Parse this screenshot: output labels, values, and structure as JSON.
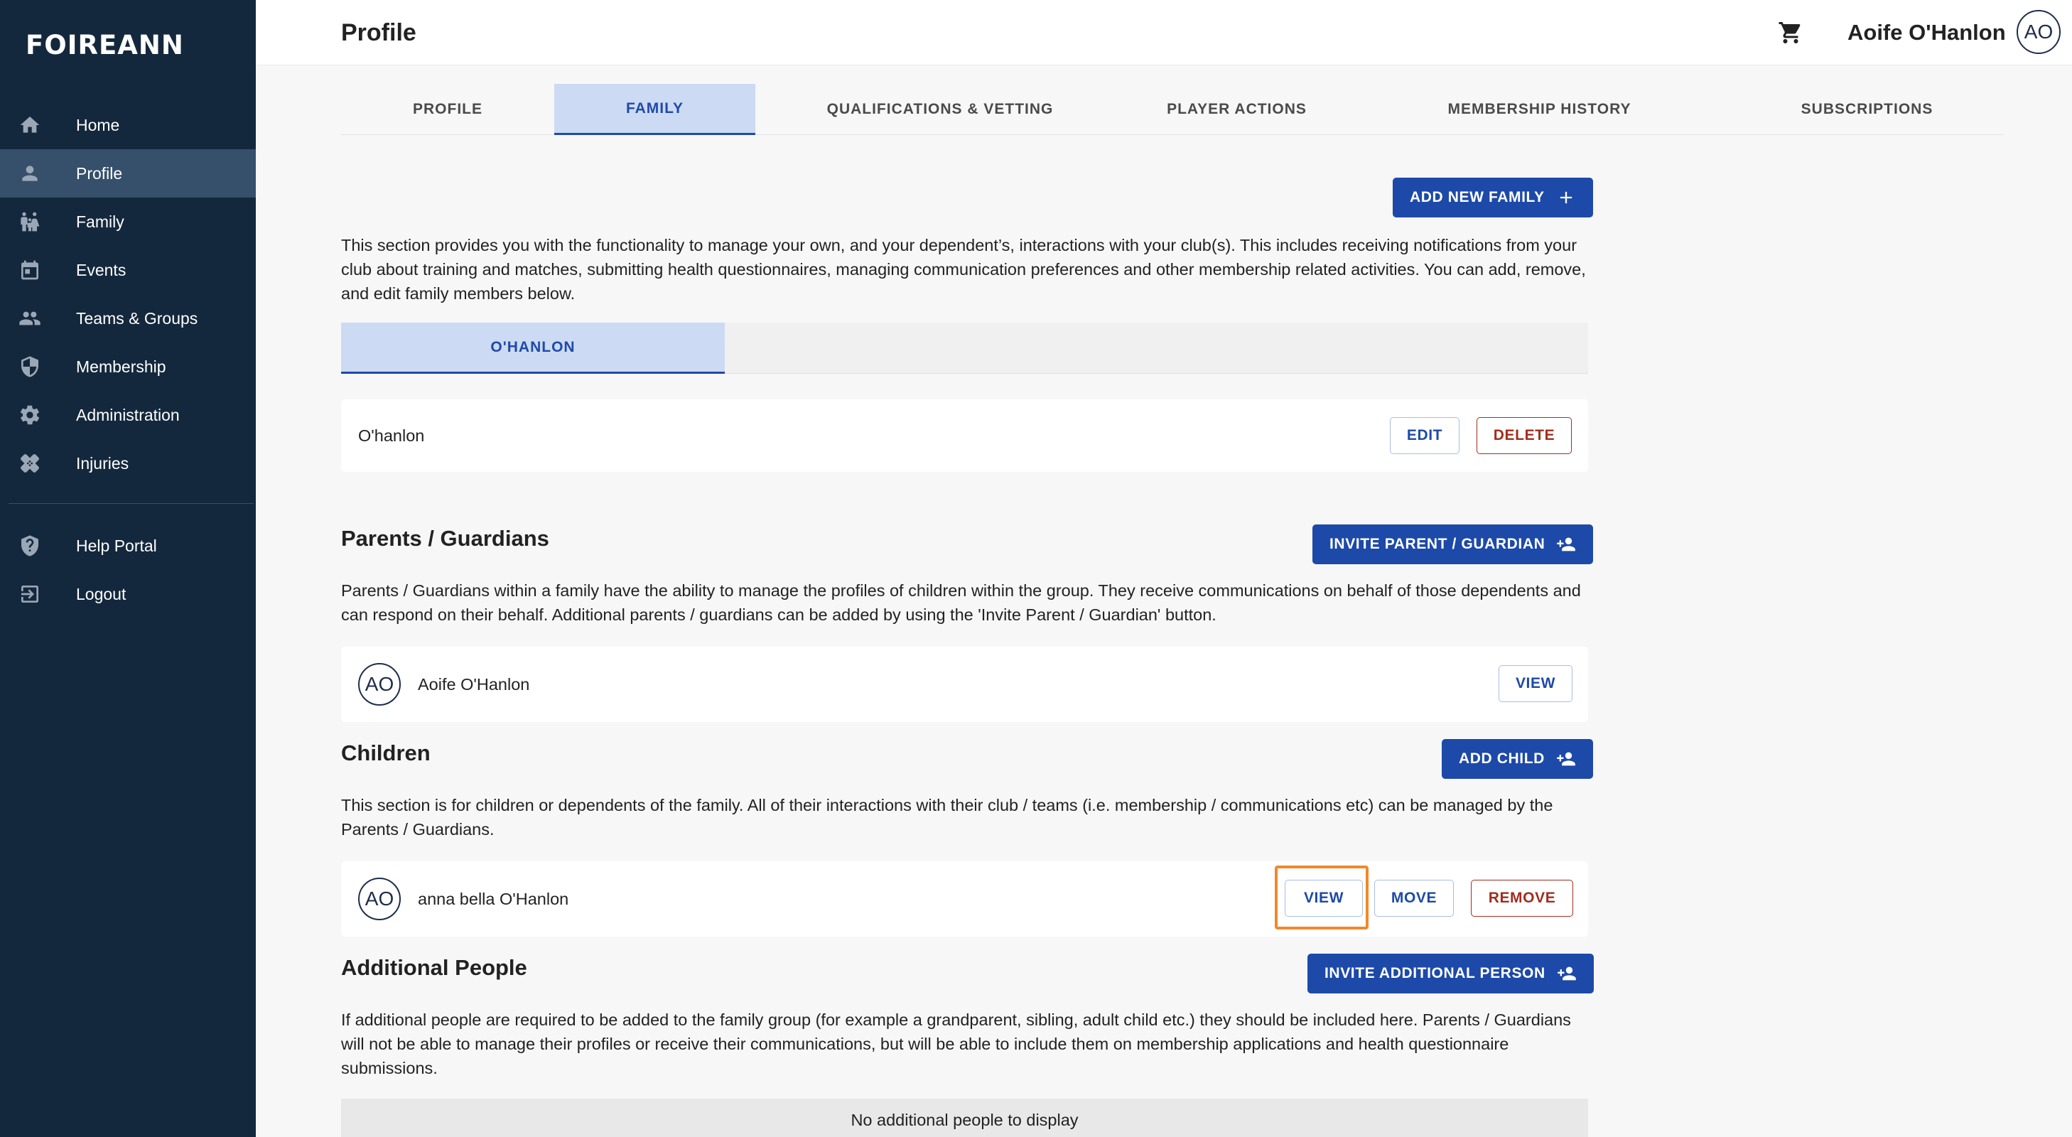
{
  "brand": {
    "logo": "FOIREANN"
  },
  "sidebar": {
    "items": [
      {
        "label": "Home",
        "icon": "home-icon"
      },
      {
        "label": "Profile",
        "icon": "person-icon",
        "active": true
      },
      {
        "label": "Family",
        "icon": "family-icon"
      },
      {
        "label": "Events",
        "icon": "calendar-icon"
      },
      {
        "label": "Teams & Groups",
        "icon": "group-icon"
      },
      {
        "label": "Membership",
        "icon": "shield-icon"
      },
      {
        "label": "Administration",
        "icon": "gear-icon"
      },
      {
        "label": "Injuries",
        "icon": "bandage-icon"
      }
    ],
    "secondary": [
      {
        "label": "Help Portal",
        "icon": "help-icon"
      },
      {
        "label": "Logout",
        "icon": "logout-icon"
      }
    ]
  },
  "header": {
    "title": "Profile",
    "user_name": "Aoife O'Hanlon",
    "avatar_initials": "AO"
  },
  "tabs": [
    {
      "label": "PROFILE"
    },
    {
      "label": "FAMILY",
      "active": true
    },
    {
      "label": "QUALIFICATIONS & VETTING"
    },
    {
      "label": "PLAYER ACTIONS"
    },
    {
      "label": "MEMBERSHIP HISTORY"
    },
    {
      "label": "SUBSCRIPTIONS"
    }
  ],
  "family": {
    "add_button": "ADD NEW FAMILY",
    "intro": "This section provides you with the functionality to manage your own, and your dependent’s, interactions with your club(s). This includes receiving notifications from your club about training and matches, submitting health questionnaires, managing communication preferences and other membership related activities. You can add, remove, and edit family members below.",
    "family_tab": "O'HANLON",
    "family_name": "O'hanlon",
    "edit_button": "EDIT",
    "delete_button": "DELETE"
  },
  "parents": {
    "title": "Parents / Guardians",
    "invite_button": "INVITE PARENT / GUARDIAN",
    "description": "Parents / Guardians within a family have the ability to manage the profiles of children within the group. They receive communications on behalf of those dependents and can respond on their behalf. Additional parents / guardians can be added by using the 'Invite Parent / Guardian' button.",
    "member": {
      "initials": "AO",
      "name": "Aoife O'Hanlon",
      "view_button": "VIEW"
    }
  },
  "children": {
    "title": "Children",
    "add_button": "ADD CHILD",
    "description": "This section is for children or dependents of the family. All of their interactions with their club / teams (i.e. membership / communications etc) can be managed by the Parents / Guardians.",
    "member": {
      "initials": "AO",
      "name": "anna bella O'Hanlon",
      "view_button": "VIEW",
      "move_button": "MOVE",
      "remove_button": "REMOVE"
    }
  },
  "additional": {
    "title": "Additional People",
    "invite_button": "INVITE ADDITIONAL PERSON",
    "description": "If additional people are required to be added to the family group (for example a grandparent, sibling, adult child etc.) they should be included here. Parents / Guardians will not be able to manage their profiles or receive their communications, but will be able to include them on membership applications and health questionnaire submissions.",
    "empty_text": "No additional people to display"
  },
  "colors": {
    "sidebar_bg": "#14283d",
    "sidebar_active": "#36506b",
    "primary": "#1d4aa8",
    "tab_active_bg": "#ccdaf3",
    "danger": "#a02e1e",
    "highlight": "#ee8a2c"
  }
}
